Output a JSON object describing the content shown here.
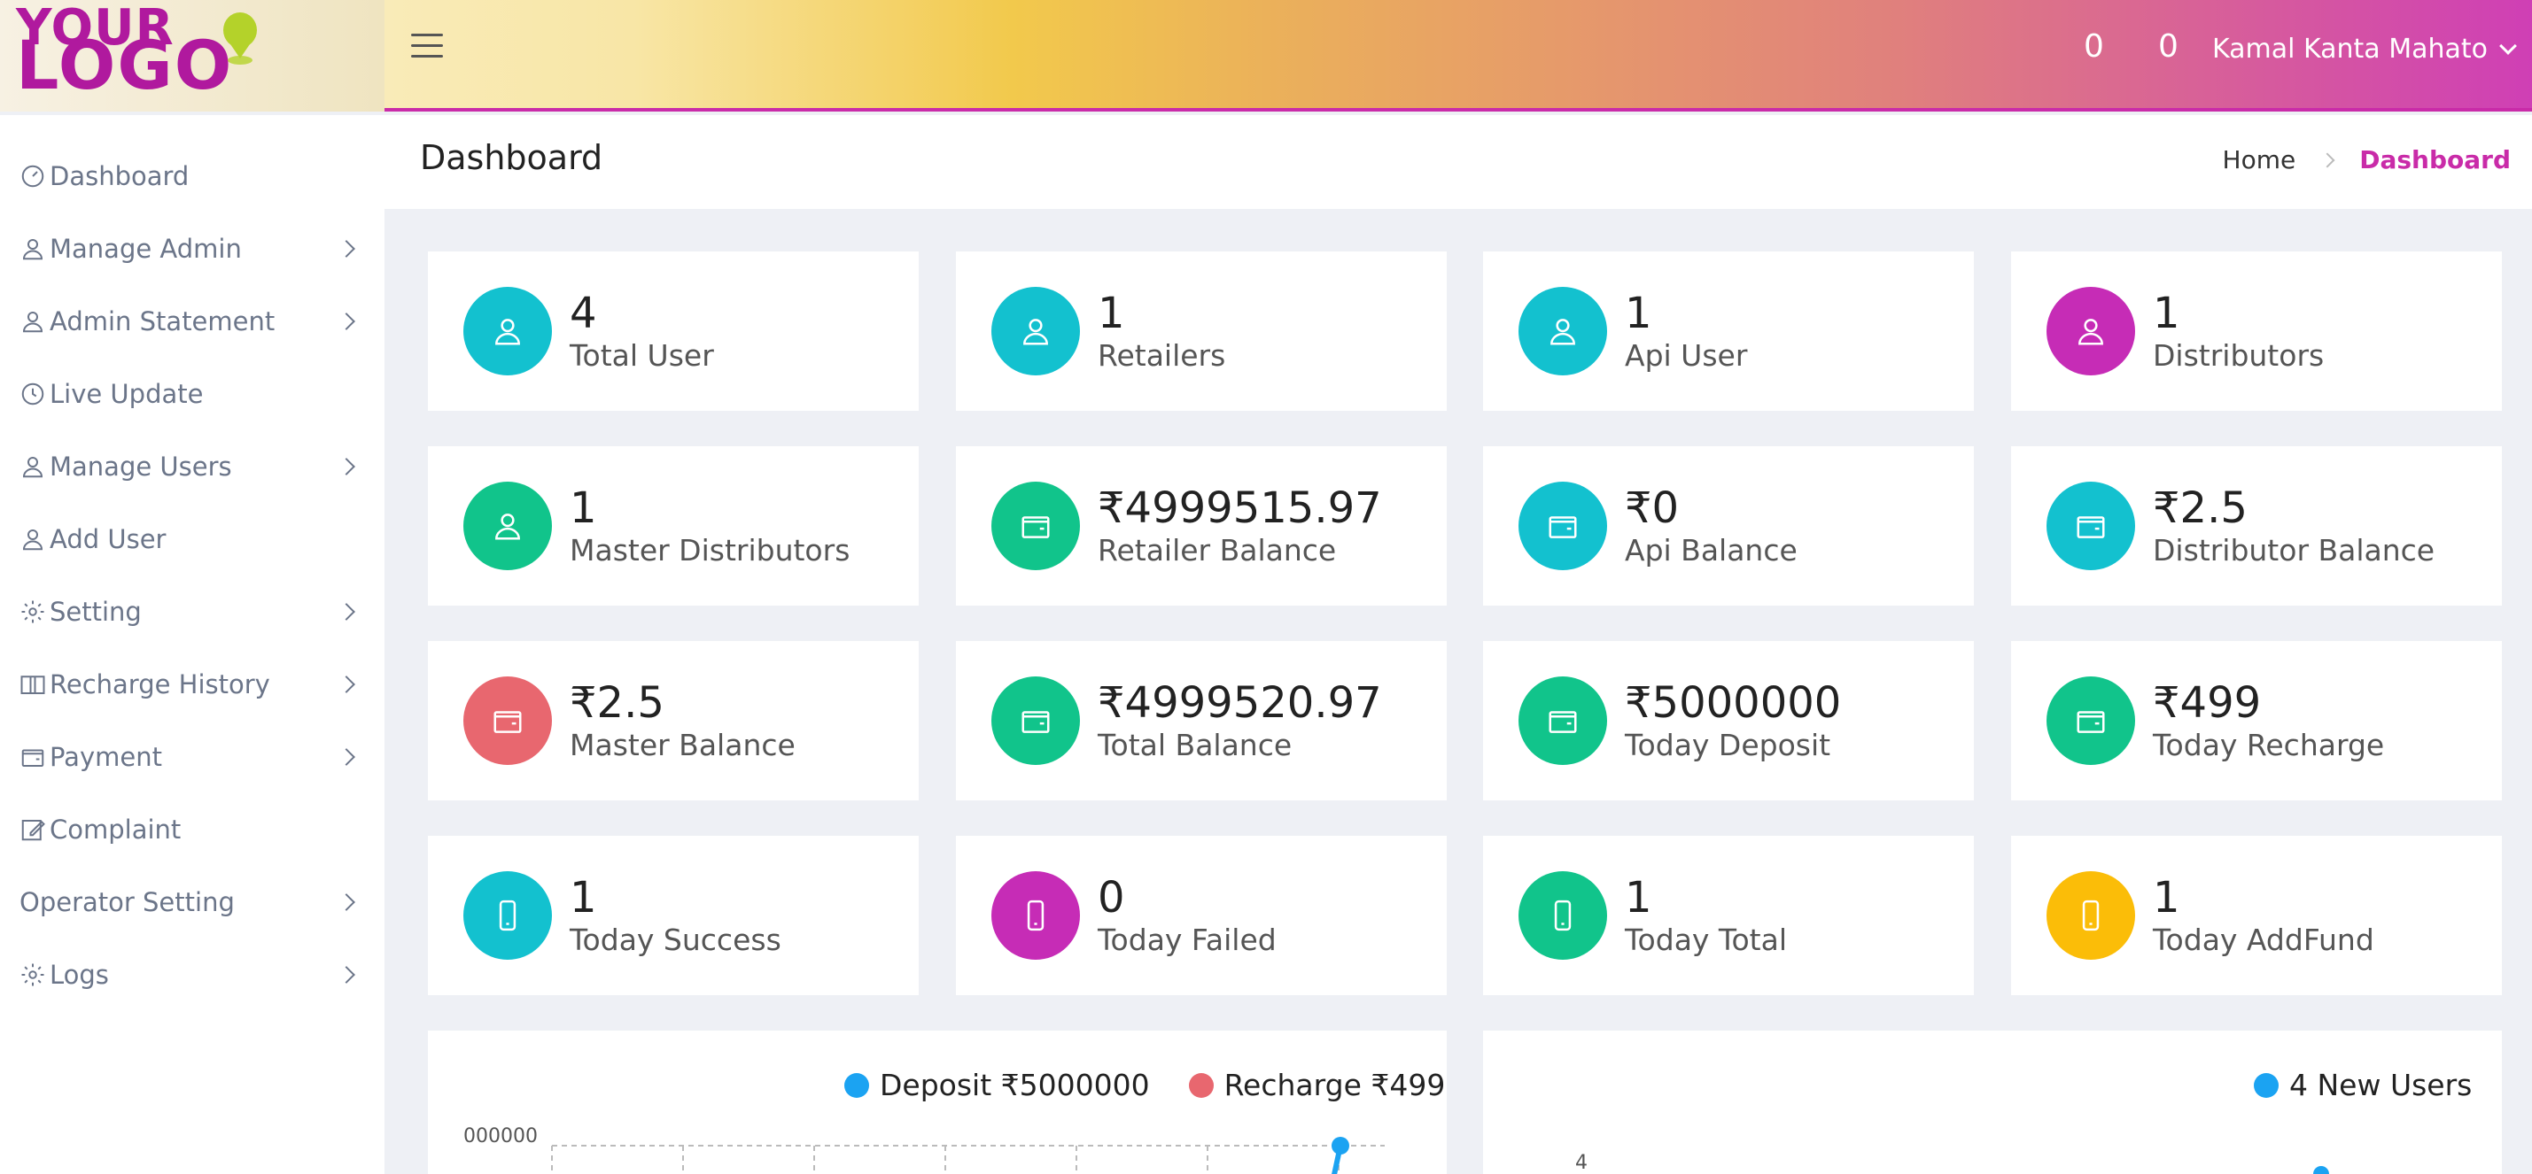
{
  "header": {
    "logo_line1": "YOUR",
    "logo_line2": "LOGO",
    "count1": "0",
    "count2": "0",
    "user_name": "Kamal Kanta Mahato"
  },
  "sidebar": {
    "items": [
      {
        "label": "Dashboard",
        "icon": "speedometer-icon",
        "arrow": false
      },
      {
        "label": "Manage Admin",
        "icon": "user-icon",
        "arrow": true
      },
      {
        "label": "Admin Statement",
        "icon": "user-icon",
        "arrow": true
      },
      {
        "label": "Live Update",
        "icon": "clock-icon",
        "arrow": false
      },
      {
        "label": "Manage Users",
        "icon": "user-icon",
        "arrow": true
      },
      {
        "label": "Add User",
        "icon": "user-icon",
        "arrow": false
      },
      {
        "label": "Setting",
        "icon": "gear-icon",
        "arrow": true
      },
      {
        "label": "Recharge History",
        "icon": "book-icon",
        "arrow": true
      },
      {
        "label": "Payment",
        "icon": "wallet-icon",
        "arrow": true
      },
      {
        "label": "Complaint",
        "icon": "edit-icon",
        "arrow": false
      },
      {
        "label": "Operator Setting",
        "icon": "",
        "arrow": true
      },
      {
        "label": "Logs",
        "icon": "gear-icon",
        "arrow": true
      }
    ]
  },
  "page": {
    "title": "Dashboard",
    "breadcrumb_home": "Home",
    "breadcrumb_active": "Dashboard"
  },
  "cards": [
    {
      "value": "4",
      "label": "Total User",
      "color": "#13c1cf",
      "icon": "user-icon"
    },
    {
      "value": "1",
      "label": "Retailers",
      "color": "#13c1cf",
      "icon": "user-icon"
    },
    {
      "value": "1",
      "label": "Api User",
      "color": "#13c1cf",
      "icon": "user-icon"
    },
    {
      "value": "1",
      "label": "Distributors",
      "color": "#c62cb6",
      "icon": "user-icon"
    },
    {
      "value": "1",
      "label": "Master Distributors",
      "color": "#11c48b",
      "icon": "user-icon"
    },
    {
      "value": "₹4999515.97",
      "label": "Retailer Balance",
      "color": "#11c48b",
      "icon": "wallet-icon"
    },
    {
      "value": "₹0",
      "label": "Api Balance",
      "color": "#13c1cf",
      "icon": "wallet-icon"
    },
    {
      "value": "₹2.5",
      "label": "Distributor Balance",
      "color": "#13c1cf",
      "icon": "wallet-icon"
    },
    {
      "value": "₹2.5",
      "label": "Master Balance",
      "color": "#e8676f",
      "icon": "wallet-icon"
    },
    {
      "value": "₹4999520.97",
      "label": "Total Balance",
      "color": "#11c48b",
      "icon": "wallet-icon"
    },
    {
      "value": "₹5000000",
      "label": "Today Deposit",
      "color": "#11c48b",
      "icon": "wallet-icon"
    },
    {
      "value": "₹499",
      "label": "Today Recharge",
      "color": "#11c48b",
      "icon": "wallet-icon"
    },
    {
      "value": "1",
      "label": "Today Success",
      "color": "#13c1cf",
      "icon": "phone-icon"
    },
    {
      "value": "0",
      "label": "Today Failed",
      "color": "#c62cb6",
      "icon": "phone-icon"
    },
    {
      "value": "1",
      "label": "Today Total",
      "color": "#11c48b",
      "icon": "phone-icon"
    },
    {
      "value": "1",
      "label": "Today AddFund",
      "color": "#fbbd08",
      "icon": "phone-icon"
    }
  ],
  "chart_data": [
    {
      "type": "line",
      "title": "",
      "series": [
        {
          "name": "Deposit ₹5000000",
          "color": "#1ba3f2"
        },
        {
          "name": "Recharge ₹499",
          "color": "#e8676f"
        }
      ],
      "y_tick_visible": "000000"
    },
    {
      "type": "line",
      "title": "",
      "series": [
        {
          "name": "4 New Users",
          "color": "#1ba3f2"
        }
      ],
      "y_tick_visible": "4"
    }
  ]
}
